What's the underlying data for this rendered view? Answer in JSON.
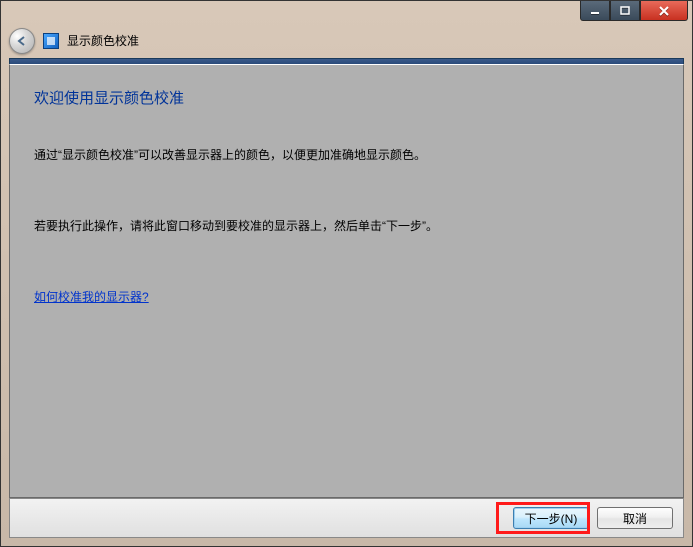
{
  "window": {
    "title": "显示颜色校准"
  },
  "content": {
    "heading": "欢迎使用显示颜色校准",
    "para1": "通过“显示颜色校准”可以改善显示器上的颜色，以便更加准确地显示颜色。",
    "para2": "若要执行此操作，请将此窗口移动到要校准的显示器上，然后单击“下一步”。",
    "help_link": "如何校准我的显示器?"
  },
  "footer": {
    "next_label": "下一步(N)",
    "cancel_label": "取消"
  }
}
